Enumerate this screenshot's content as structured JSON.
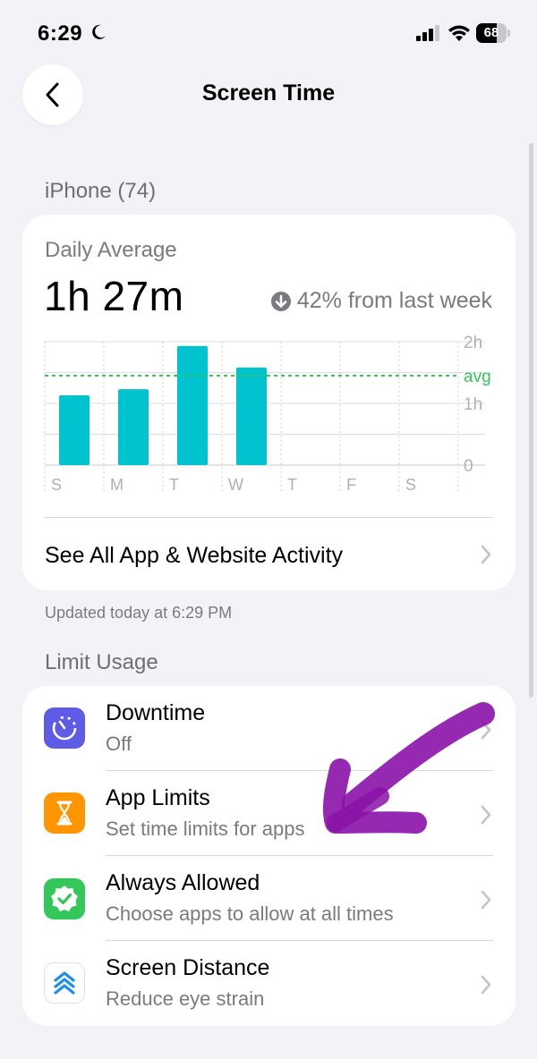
{
  "status_bar": {
    "time": "6:29",
    "battery": "68",
    "battery_level": 0.68
  },
  "nav": {
    "title": "Screen Time",
    "back_icon": "chevron-left-icon"
  },
  "device_section": {
    "header": "iPhone (74)"
  },
  "usage_card": {
    "daily_average_label": "Daily Average",
    "daily_average_value": "1h 27m",
    "trend_text": "42% from last week",
    "trend_icon": "arrow-down-circle-icon",
    "activity_link": "See All App & Website Activity"
  },
  "chart_data": {
    "type": "bar",
    "categories": [
      "S",
      "M",
      "T",
      "W",
      "T",
      "F",
      "S"
    ],
    "values": [
      1.13,
      1.23,
      1.93,
      1.58,
      0,
      0,
      0
    ],
    "y_tick_labels": [
      "2h",
      "1h",
      "0"
    ],
    "ylim": [
      0,
      2
    ],
    "avg_label": "avg",
    "avg_value": 1.45,
    "bar_color": "#00c3d0",
    "avg_line_color": "#34c759",
    "grid": true
  },
  "updated_text": "Updated today at 6:29 PM",
  "limit_section": {
    "header": "Limit Usage",
    "items": [
      {
        "title": "Downtime",
        "subtitle": "Off",
        "icon": "downtime-icon",
        "color": "#5e5ce6"
      },
      {
        "title": "App Limits",
        "subtitle": "Set time limits for apps",
        "icon": "hourglass-icon",
        "color": "#ff9500"
      },
      {
        "title": "Always Allowed",
        "subtitle": "Choose apps to allow at all times",
        "icon": "checkmark-seal-icon",
        "color": "#34c759"
      },
      {
        "title": "Screen Distance",
        "subtitle": "Reduce eye strain",
        "icon": "screen-distance-icon",
        "color": "#ffffff"
      }
    ]
  },
  "annotation": {
    "color": "#8a12a8"
  }
}
